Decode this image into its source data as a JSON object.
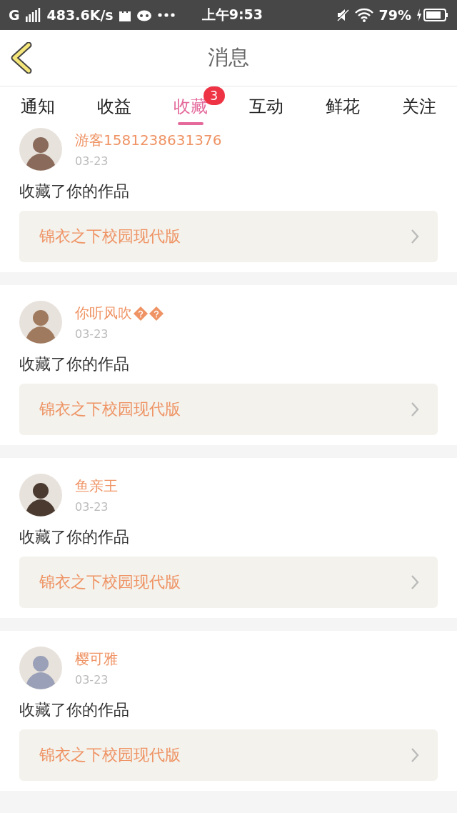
{
  "status_bar": {
    "network": "G",
    "speed": "483.6K/s",
    "time": "上午9:53",
    "battery": "79%"
  },
  "header": {
    "title": "消息"
  },
  "tabs": [
    {
      "label": "通知",
      "selected": false
    },
    {
      "label": "收益",
      "selected": false
    },
    {
      "label": "收藏",
      "selected": true,
      "badge": "3"
    },
    {
      "label": "互动",
      "selected": false
    },
    {
      "label": "鲜花",
      "selected": false
    },
    {
      "label": "关注",
      "selected": false
    }
  ],
  "messages": [
    {
      "user": "游客1581238631376",
      "date": "03-23",
      "action": "收藏了你的作品",
      "work": "锦衣之下校园现代版",
      "color": "#8a6a5a"
    },
    {
      "user": "你听风吹",
      "name_icons": [
        {
          "kind": "replacement"
        },
        {
          "kind": "replacement"
        }
      ],
      "date": "03-23",
      "action": "收藏了你的作品",
      "work": "锦衣之下校园现代版",
      "color": "#a07a5e"
    },
    {
      "user": "鱼亲王",
      "date": "03-23",
      "action": "收藏了你的作品",
      "work": "锦衣之下校园现代版",
      "color": "#4a3a30"
    },
    {
      "user": "樱可雅",
      "date": "03-23",
      "action": "收藏了你的作品",
      "work": "锦衣之下校园现代版",
      "color": "#9aa0b8"
    }
  ]
}
